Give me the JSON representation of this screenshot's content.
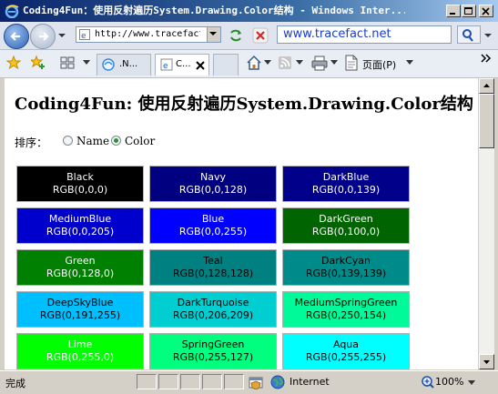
{
  "window": {
    "title": "Coding4Fun：使用反射遍历System.Drawing.Color结构 - Windows Inter..."
  },
  "navbar": {
    "address": "http://www.tracefact",
    "search_text": "www.tracefact.net"
  },
  "tabs": [
    {
      "label": ".N..."
    },
    {
      "label": "C..."
    }
  ],
  "commands": {
    "page_menu": "页面(P)"
  },
  "page": {
    "title": "Coding4Fun: 使用反射遍历System.Drawing.Color结构",
    "sort_label": "排序：",
    "sort_options": [
      {
        "label": "Name",
        "checked": false
      },
      {
        "label": "Color",
        "checked": true
      }
    ]
  },
  "colors": [
    {
      "name": "Black",
      "rgb": "RGB(0,0,0)",
      "bg": "#000000",
      "fg": "#ffffff"
    },
    {
      "name": "Navy",
      "rgb": "RGB(0,0,128)",
      "bg": "#000080",
      "fg": "#ffffff"
    },
    {
      "name": "DarkBlue",
      "rgb": "RGB(0,0,139)",
      "bg": "#00008b",
      "fg": "#ffffff"
    },
    {
      "name": "MediumBlue",
      "rgb": "RGB(0,0,205)",
      "bg": "#0000cd",
      "fg": "#ffffff"
    },
    {
      "name": "Blue",
      "rgb": "RGB(0,0,255)",
      "bg": "#0000ff",
      "fg": "#ffffff"
    },
    {
      "name": "DarkGreen",
      "rgb": "RGB(0,100,0)",
      "bg": "#006400",
      "fg": "#ffffff"
    },
    {
      "name": "Green",
      "rgb": "RGB(0,128,0)",
      "bg": "#008000",
      "fg": "#ffffff"
    },
    {
      "name": "Teal",
      "rgb": "RGB(0,128,128)",
      "bg": "#008080",
      "fg": "#000000"
    },
    {
      "name": "DarkCyan",
      "rgb": "RGB(0,139,139)",
      "bg": "#008b8b",
      "fg": "#000000"
    },
    {
      "name": "DeepSkyBlue",
      "rgb": "RGB(0,191,255)",
      "bg": "#00bfff",
      "fg": "#000000"
    },
    {
      "name": "DarkTurquoise",
      "rgb": "RGB(0,206,209)",
      "bg": "#00ced1",
      "fg": "#000000"
    },
    {
      "name": "MediumSpringGreen",
      "rgb": "RGB(0,250,154)",
      "bg": "#00fa9a",
      "fg": "#000000"
    },
    {
      "name": "Lime",
      "rgb": "RGB(0,255,0)",
      "bg": "#00ff00",
      "fg": "#ffffff"
    },
    {
      "name": "SpringGreen",
      "rgb": "RGB(0,255,127)",
      "bg": "#00ff7f",
      "fg": "#000000"
    },
    {
      "name": "Aqua",
      "rgb": "RGB(0,255,255)",
      "bg": "#00ffff",
      "fg": "#000000"
    }
  ],
  "status": {
    "text": "完成",
    "zone": "Internet",
    "zoom": "100%"
  }
}
